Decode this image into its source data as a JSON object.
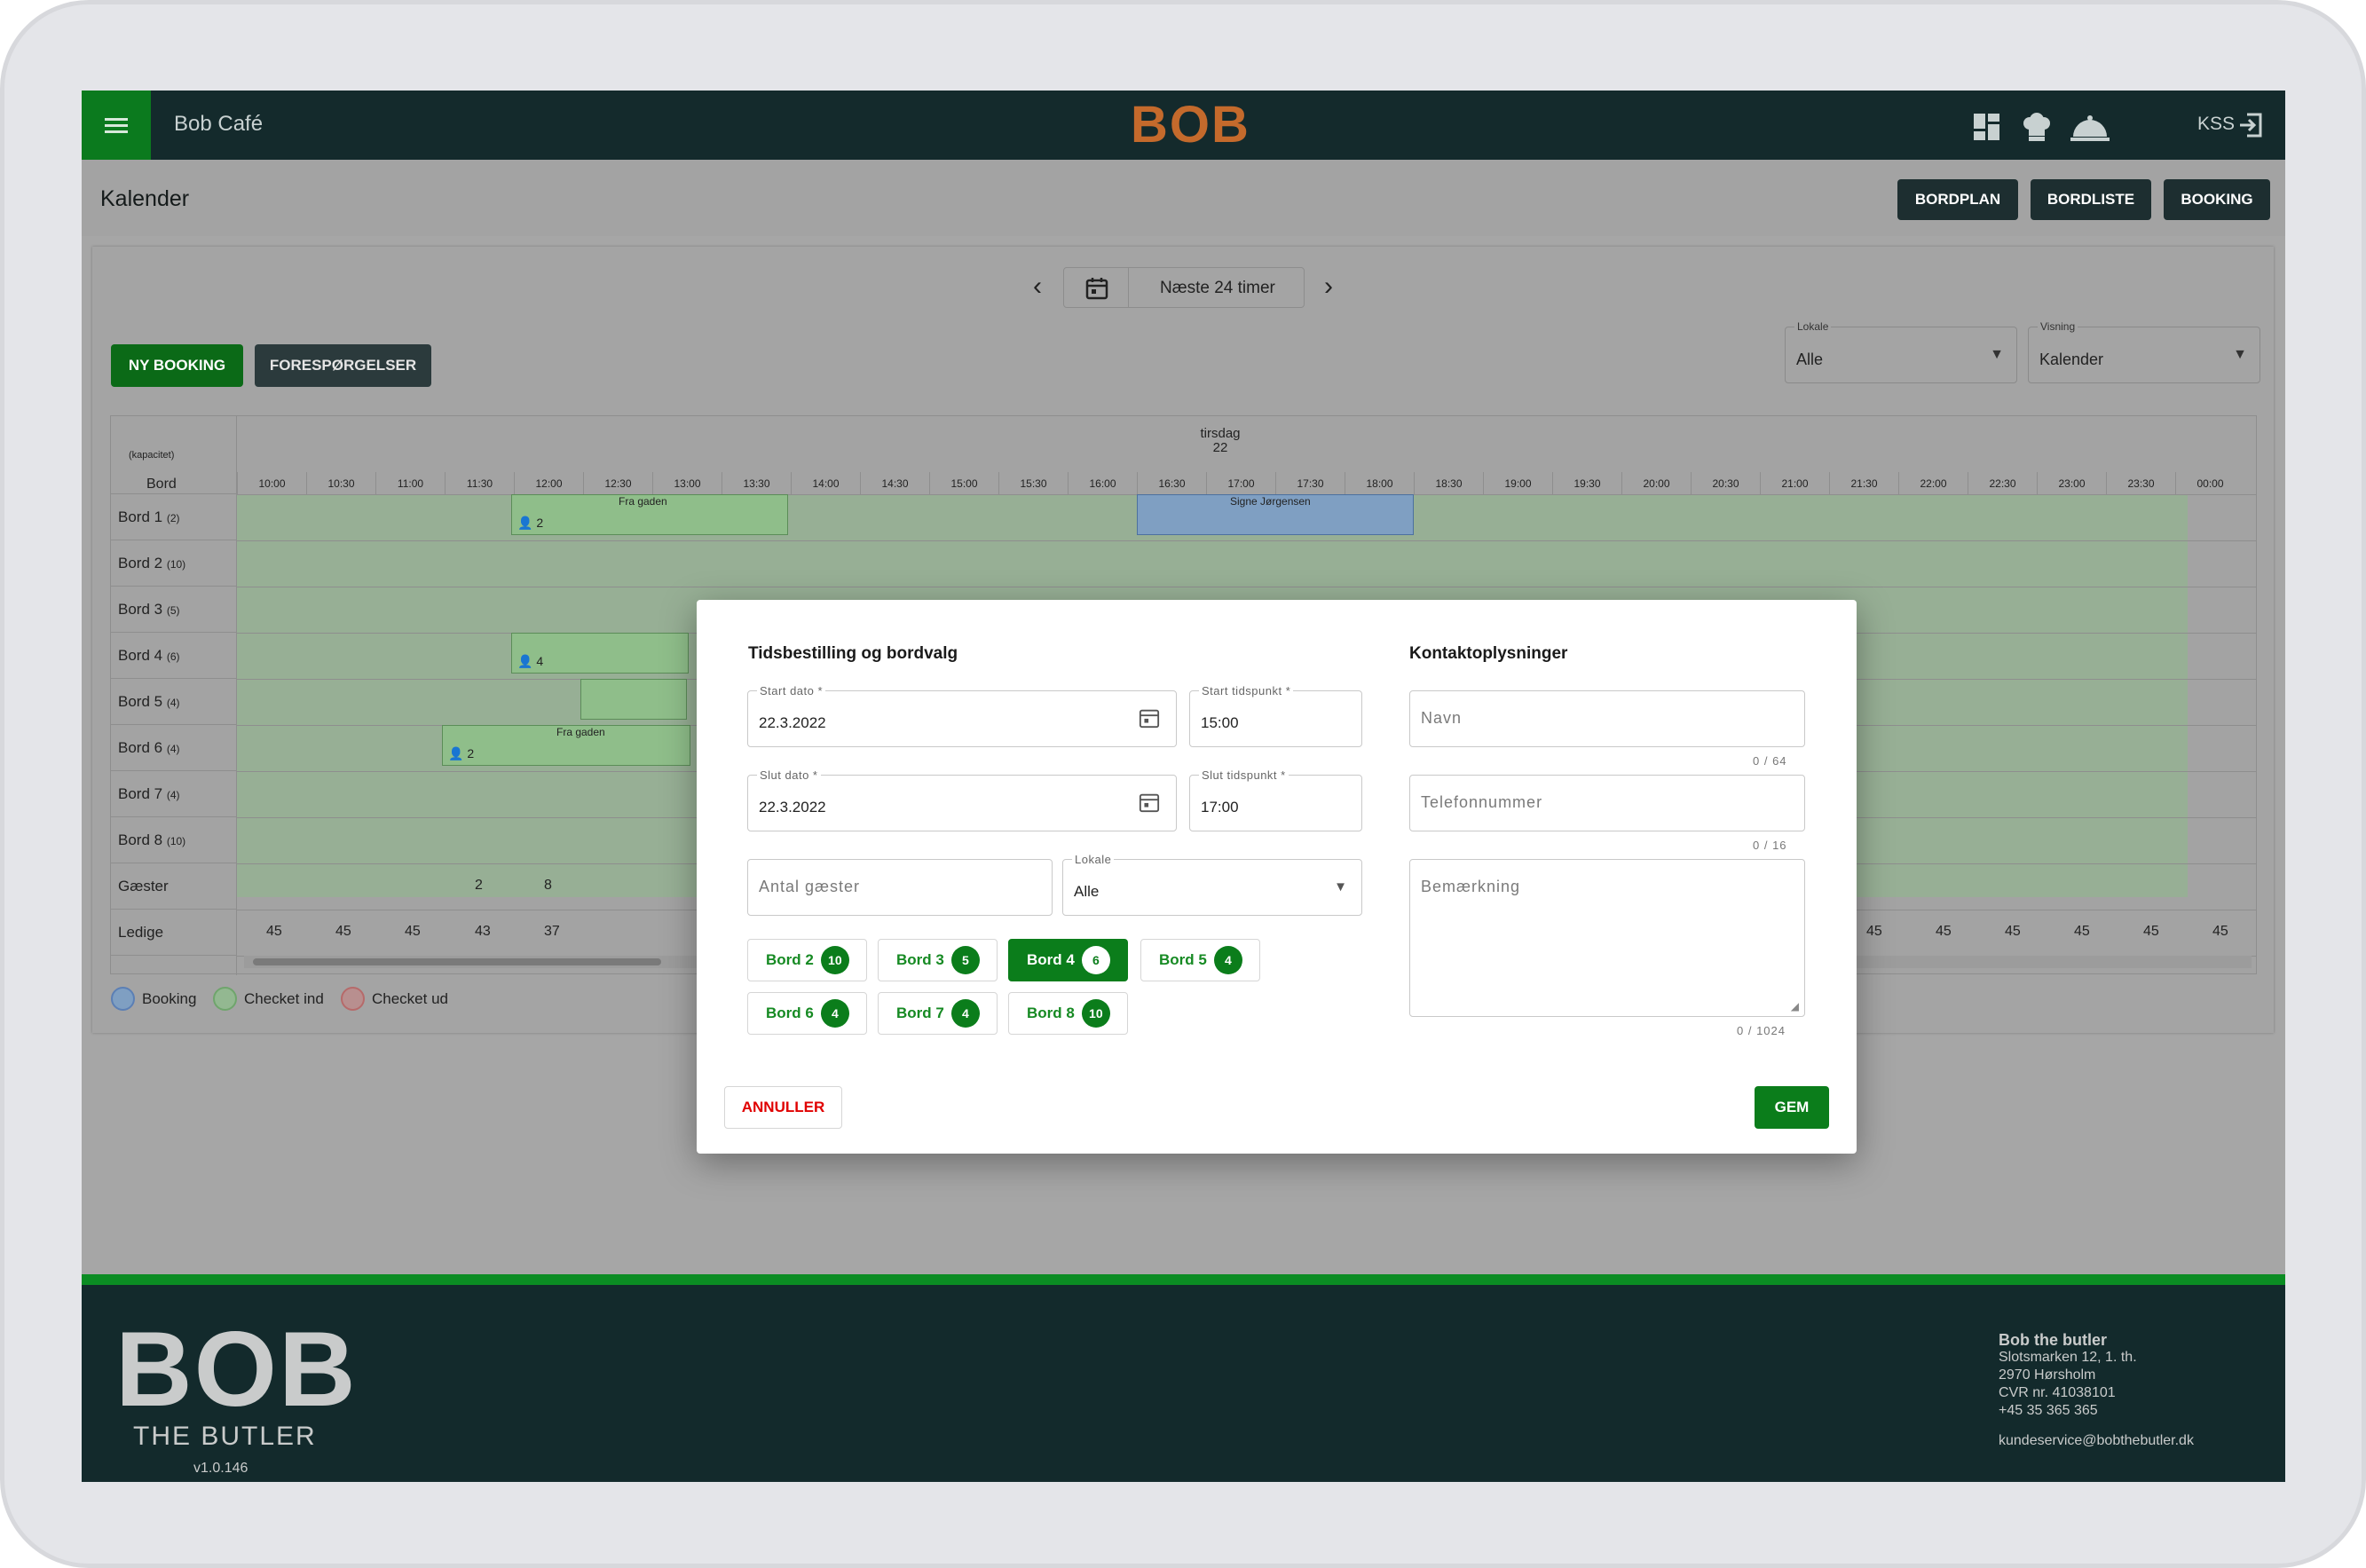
{
  "header": {
    "app_title": "Bob Café",
    "logo_text": "BOB",
    "user_label": "KSS",
    "icons": [
      "dashboard-icon",
      "chef-hat-icon",
      "cloche-icon",
      "logout-icon"
    ]
  },
  "page": {
    "title": "Kalender",
    "buttons": {
      "bordplan": "BORDPLAN",
      "bordliste": "BORDLISTE",
      "booking": "BOOKING"
    }
  },
  "toolbar": {
    "date_label": "Næste 24 timer",
    "new_booking": "NY BOOKING",
    "requests": "FORESPØRGELSER",
    "lokale_label": "Lokale",
    "lokale_value": "Alle",
    "visning_label": "Visning",
    "visning_value": "Kalender"
  },
  "calendar": {
    "column_header": "Bord",
    "column_header_sub": "(kapacitet)",
    "day_name": "tirsdag",
    "day_number": "22",
    "times": [
      "10:00",
      "10:30",
      "11:00",
      "11:30",
      "12:00",
      "12:30",
      "13:00",
      "13:30",
      "14:00",
      "14:30",
      "15:00",
      "15:30",
      "16:00",
      "16:30",
      "17:00",
      "17:30",
      "18:00",
      "18:30",
      "19:00",
      "19:30",
      "20:00",
      "20:30",
      "21:00",
      "21:30",
      "22:00",
      "22:30",
      "23:00",
      "23:30",
      "00:00"
    ],
    "rows": [
      {
        "name": "Bord 1",
        "cap": "(2)"
      },
      {
        "name": "Bord 2",
        "cap": "(10)"
      },
      {
        "name": "Bord 3",
        "cap": "(5)"
      },
      {
        "name": "Bord 4",
        "cap": "(6)"
      },
      {
        "name": "Bord 5",
        "cap": "(4)"
      },
      {
        "name": "Bord 6",
        "cap": "(4)"
      },
      {
        "name": "Bord 7",
        "cap": "(4)"
      },
      {
        "name": "Bord 8",
        "cap": "(10)"
      }
    ],
    "guests_label": "Gæster",
    "free_label": "Ledige",
    "guests_values": [
      "2",
      "8"
    ],
    "free_values_left": [
      "45",
      "45",
      "45",
      "43",
      "37"
    ],
    "free_values_right": [
      "45",
      "45",
      "45",
      "45",
      "45",
      "45",
      "45"
    ],
    "bookings": [
      {
        "label": "Fra gaden",
        "guests": "2"
      },
      {
        "label": "Signe Jørgensen",
        "guests": ""
      },
      {
        "label": "",
        "guests": "4"
      },
      {
        "label": "",
        "guests": "2"
      },
      {
        "label": "Fra gaden",
        "guests": "2"
      }
    ]
  },
  "legend": {
    "booking": "Booking",
    "checked_in": "Checket ind",
    "checked_out": "Checket ud",
    "colors": {
      "booking": "#6f9bd6",
      "checked_in": "#86c683",
      "checked_out": "#d87f7f"
    }
  },
  "modal": {
    "left_title": "Tidsbestilling og bordvalg",
    "right_title": "Kontaktoplysninger",
    "start_date_label": "Start dato *",
    "start_date": "22.3.2022",
    "start_time_label": "Start tidspunkt *",
    "start_time": "15:00",
    "end_date_label": "Slut dato *",
    "end_date": "22.3.2022",
    "end_time_label": "Slut tidspunkt *",
    "end_time": "17:00",
    "guests_placeholder": "Antal gæster",
    "lokale_label": "Lokale",
    "lokale_value": "Alle",
    "tables": [
      {
        "name": "Bord 2",
        "cap": "10",
        "selected": false
      },
      {
        "name": "Bord 3",
        "cap": "5",
        "selected": false
      },
      {
        "name": "Bord 4",
        "cap": "6",
        "selected": true
      },
      {
        "name": "Bord 5",
        "cap": "4",
        "selected": false
      },
      {
        "name": "Bord 6",
        "cap": "4",
        "selected": false
      },
      {
        "name": "Bord 7",
        "cap": "4",
        "selected": false
      },
      {
        "name": "Bord 8",
        "cap": "10",
        "selected": false
      }
    ],
    "name_placeholder": "Navn",
    "name_counter": "0 / 64",
    "phone_placeholder": "Telefonnummer",
    "phone_counter": "0 / 16",
    "note_placeholder": "Bemærkning",
    "note_counter": "0 / 1024",
    "cancel": "ANNULLER",
    "save": "GEM"
  },
  "footer": {
    "logo_text": "BOB",
    "tagline": "THE BUTLER",
    "version": "v1.0.146",
    "company": "Bob the butler",
    "address1": "Slotsmarken 12, 1. th.",
    "address2": "2970 Hørsholm",
    "cvr": "CVR nr. 41038101",
    "phone": "+45 35 365 365",
    "email": "kundeservice@bobthebutler.dk"
  }
}
